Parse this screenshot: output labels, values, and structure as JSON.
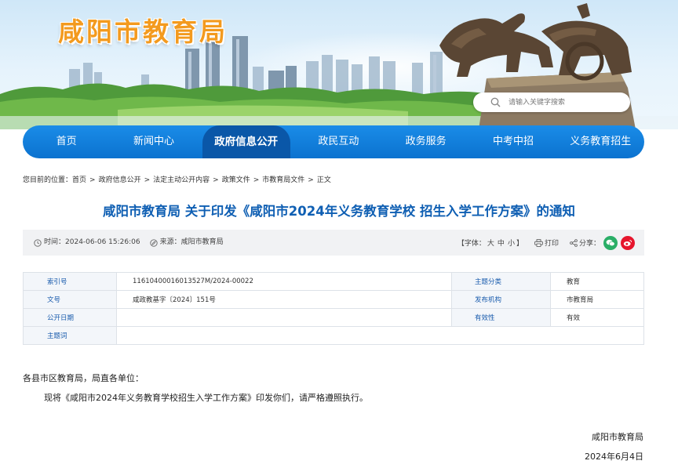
{
  "header": {
    "site_title": "咸阳市教育局",
    "search_placeholder": "请输入关键字搜索",
    "search_icon": "magnifier-icon"
  },
  "nav": {
    "items": [
      {
        "label": "首页",
        "active": false
      },
      {
        "label": "新闻中心",
        "active": false
      },
      {
        "label": "政府信息公开",
        "active": true
      },
      {
        "label": "政民互动",
        "active": false
      },
      {
        "label": "政务服务",
        "active": false
      },
      {
        "label": "中考中招",
        "active": false
      },
      {
        "label": "义务教育招生",
        "active": false
      }
    ]
  },
  "breadcrumb": {
    "prefix": "您目前的位置：",
    "items": [
      "首页",
      "政府信息公开",
      "法定主动公开内容",
      "政策文件",
      "市教育局文件",
      "正文"
    ],
    "separator": ">"
  },
  "article": {
    "title": "咸阳市教育局 关于印发《咸阳市2024年义务教育学校 招生入学工作方案》的通知"
  },
  "info_bar": {
    "time_label": "时间：",
    "time_value": "2024-06-06 15:26:06",
    "source_label": "来源：",
    "source_value": "咸阳市教育局",
    "font_size_open": "【字体：",
    "font_large": "大",
    "font_medium": "中",
    "font_small": "小",
    "font_size_close": "】",
    "print_label": "打印",
    "share_label": "分享：",
    "wechat_color": "#2aae67",
    "weibo_color": "#e6162d"
  },
  "meta": {
    "rows": [
      {
        "k1": "索引号",
        "v1": "11610400016013527M/2024-00022",
        "k2": "主题分类",
        "v2": "教育"
      },
      {
        "k1": "文号",
        "v1": "咸政教基字〔2024〕151号",
        "k2": "发布机构",
        "v2": "市教育局"
      },
      {
        "k1": "公开日期",
        "v1": "",
        "k2": "有效性",
        "v2": "有效"
      },
      {
        "k1": "主题词",
        "v1": ""
      }
    ]
  },
  "body": {
    "salutation": "各县市区教育局，局直各单位：",
    "paragraph": "现将《咸阳市2024年义务教育学校招生入学工作方案》印发你们，请严格遵照执行。",
    "signature": "咸阳市教育局",
    "date": "2024年6月4日"
  },
  "colors": {
    "nav_bg": "#0b72cf",
    "nav_active": "#0a57a8",
    "title_blue": "#0f5fb3",
    "site_title_orange": "#f39a1e"
  }
}
